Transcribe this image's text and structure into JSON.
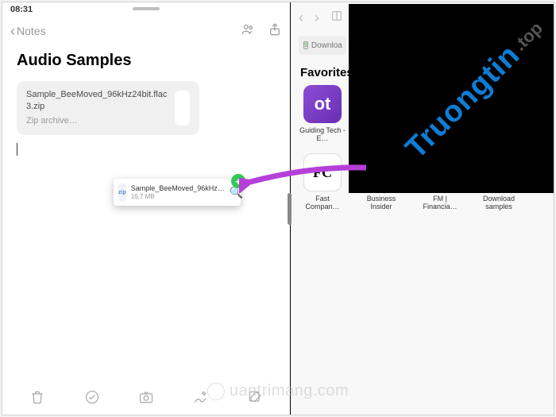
{
  "statusbar": {
    "time": "08:31"
  },
  "notes": {
    "back_label": "Notes",
    "title": "Audio Samples",
    "attachment": {
      "name": "Sample_BeeMoved_96kHz24bit.flac 3.zip",
      "subtitle": "Zip archive…"
    }
  },
  "drag": {
    "name": "Sample_BeeMoved_96kHz…",
    "size": "16,7 MB",
    "thumb_label": "zip"
  },
  "safari": {
    "url_hint": "Downloa",
    "favorites_label": "Favorites",
    "items_row1": [
      {
        "label": "Guiding Tech - E…",
        "icon_text": "ot",
        "cls": "gt-icon"
      }
    ],
    "items_row2": [
      {
        "label": "Fast Compan…",
        "icon_text": "FC",
        "cls": "fc-icon"
      },
      {
        "label": "Business Insider",
        "icon_text": "",
        "cls": "generic-icon"
      },
      {
        "label": "FM | Financia…",
        "icon_text": "",
        "cls": "generic-icon"
      },
      {
        "label": "Download samples",
        "icon_text": "",
        "cls": "generic-icon"
      }
    ]
  },
  "overlay": {
    "line1": "Truongtin",
    "line2": ".top"
  },
  "watermark": {
    "text": "uantrimang.com"
  }
}
